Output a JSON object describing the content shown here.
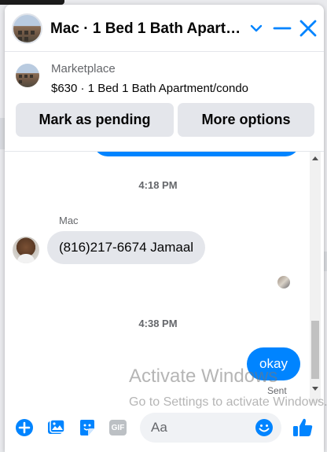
{
  "header": {
    "title": "Mac · 1 Bed 1 Bath Apartm…",
    "avatar": "apartment-building-photo",
    "icons": [
      "chevron-down-icon",
      "minimize-icon",
      "close-icon"
    ]
  },
  "product": {
    "source": "Marketplace",
    "listing": "$630 · 1 Bed 1 Bath Apartment/condo",
    "buttons": {
      "mark_pending": "Mark as pending",
      "more_options": "More options"
    }
  },
  "messages": {
    "timestamp_1": "4:18 PM",
    "sender_name": "Mac",
    "incoming_text": "(816)217-6674 Jamaal",
    "timestamp_2": "4:38 PM",
    "outgoing_text": "okay",
    "status": "Sent"
  },
  "composer": {
    "placeholder": "Aa",
    "gif_label": "GIF",
    "icons": [
      "plus-icon",
      "photo-icon",
      "sticker-icon",
      "gif-icon",
      "emoji-icon",
      "like-icon"
    ]
  },
  "watermark": {
    "title": "Activate Windows",
    "subtitle": "Go to Settings to activate Windows."
  },
  "colors": {
    "accent": "#0084ff",
    "bubble_gray": "#e4e6eb",
    "muted_text": "#65676b"
  }
}
